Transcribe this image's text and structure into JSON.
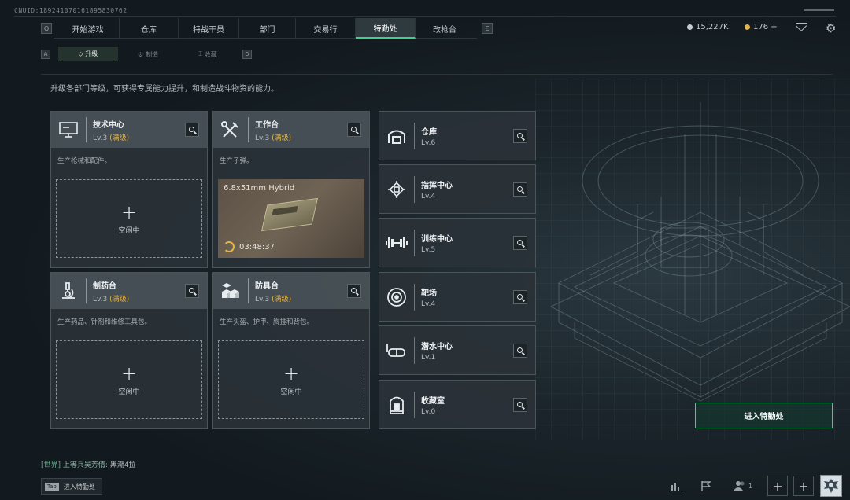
{
  "header": {
    "uid": "CNUID:1892410701618958307​62",
    "nav_left_key": "Q",
    "nav_right_key": "E",
    "tabs": [
      {
        "label": "开始游戏"
      },
      {
        "label": "仓库"
      },
      {
        "label": "特战干员"
      },
      {
        "label": "部门"
      },
      {
        "label": "交易行"
      },
      {
        "label": "特勤处",
        "active": true
      },
      {
        "label": "改枪台"
      }
    ],
    "currency": [
      {
        "value": "15,227K",
        "icon": "silver-coin-icon",
        "color": "#c7cdd1"
      },
      {
        "value": "176 +",
        "icon": "gold-coin-icon",
        "color": "#e3b449"
      }
    ]
  },
  "subnav": {
    "left_key": "A",
    "right_key": "D",
    "tabs": [
      {
        "label": "升级",
        "icon": "upgrade-icon",
        "active": true
      },
      {
        "label": "制造",
        "icon": "craft-icon"
      },
      {
        "label": "收藏",
        "icon": "collection-icon"
      }
    ]
  },
  "description": "升级各部门等级，可获得专属能力提升，和制造战斗物资的能力。",
  "cards": [
    {
      "title": "技术中心",
      "level": "Lv.3",
      "max": "(满级)",
      "subtitle": "生产枪械和配件。",
      "status": "空闲中",
      "icon": "computer-icon"
    },
    {
      "title": "工作台",
      "level": "Lv.3",
      "max": "(满级)",
      "subtitle": "生产子弹。",
      "icon": "tools-icon",
      "production": {
        "name": "6.8x51mm Hybrid",
        "timer": "03:48:37"
      }
    },
    {
      "title": "制药台",
      "level": "Lv.3",
      "max": "(满级)",
      "subtitle": "生产药品、针剂和维修工具包。",
      "status": "空闲中",
      "icon": "microscope-icon"
    },
    {
      "title": "防具台",
      "level": "Lv.3",
      "max": "(满级)",
      "subtitle": "生产头盔、护甲、胸挂和背包。",
      "status": "空闲中",
      "icon": "armor-boxes-icon"
    }
  ],
  "small_cards": [
    {
      "title": "仓库",
      "level": "Lv.6",
      "icon": "warehouse-icon"
    },
    {
      "title": "指挥中心",
      "level": "Lv.4",
      "icon": "chip-icon"
    },
    {
      "title": "训练中心",
      "level": "Lv.5",
      "icon": "dumbbell-icon"
    },
    {
      "title": "靶场",
      "level": "Lv.4",
      "icon": "target-icon"
    },
    {
      "title": "潜水中心",
      "level": "Lv.1",
      "icon": "diving-mask-icon"
    },
    {
      "title": "收藏室",
      "level": "Lv.0",
      "icon": "trophy-case-icon"
    }
  ],
  "enter_button": "进入特勤处",
  "chat": {
    "channel": "[世界]",
    "sender": "上等兵吴芳倩:",
    "message": "黑潮4拉"
  },
  "bottom": {
    "key": "Tab",
    "label": "进入特勤处",
    "friends_count": "1"
  },
  "colors": {
    "accent": "#3fd18c",
    "max_level": "#e3b449"
  }
}
